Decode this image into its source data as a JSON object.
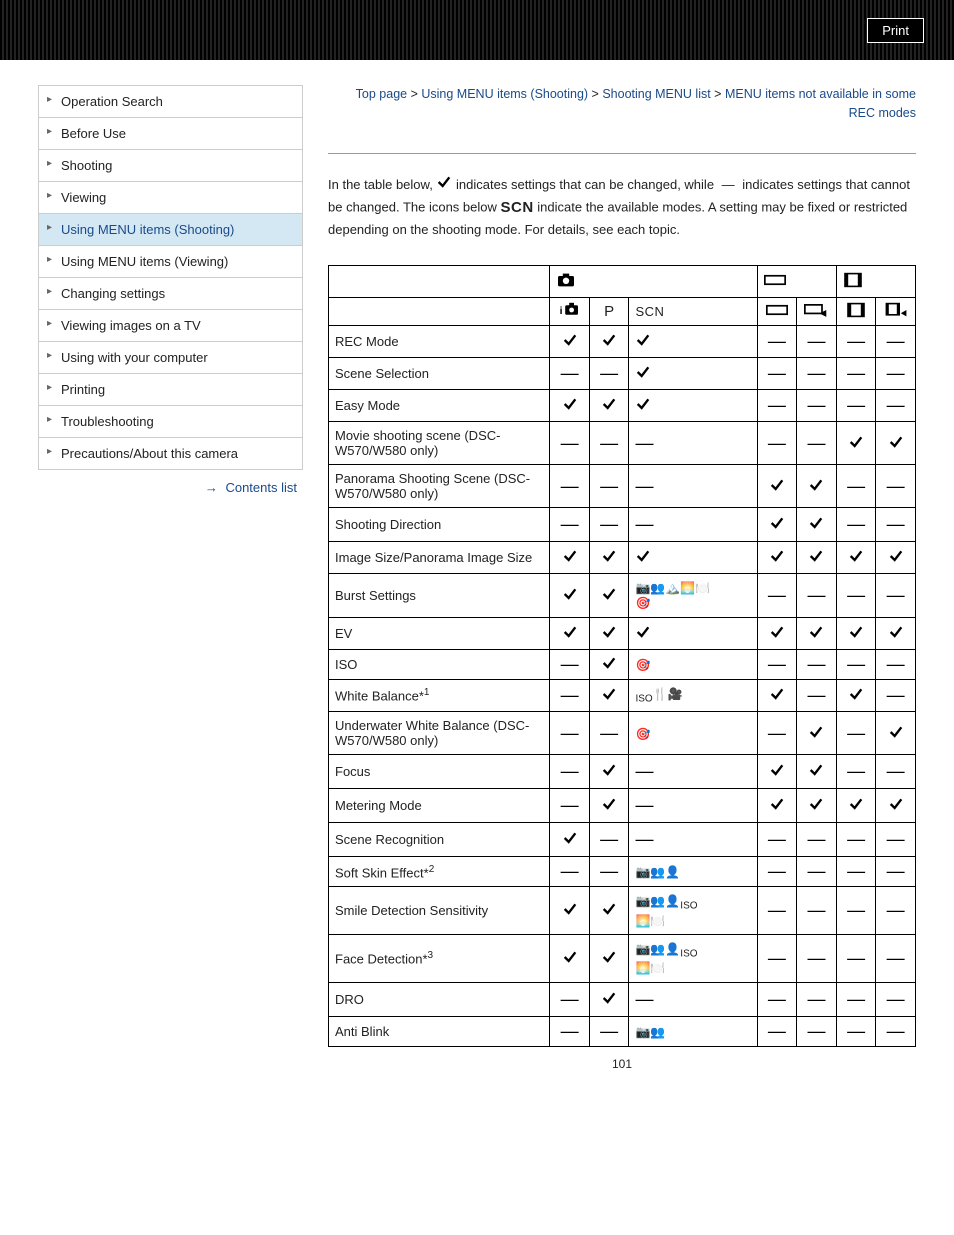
{
  "print_label": "Print",
  "breadcrumb": {
    "items": [
      "Top page",
      "Using MENU items (Shooting)",
      "Shooting MENU list",
      "MENU items not available in some REC modes"
    ],
    "sep": " > "
  },
  "sidebar": {
    "items": [
      {
        "label": "Operation Search"
      },
      {
        "label": "Before Use"
      },
      {
        "label": "Shooting"
      },
      {
        "label": "Viewing"
      },
      {
        "label": "Using MENU items (Shooting)",
        "active": true
      },
      {
        "label": "Using MENU items (Viewing)"
      },
      {
        "label": "Changing settings"
      },
      {
        "label": "Viewing images on a TV"
      },
      {
        "label": "Using with your computer"
      },
      {
        "label": "Printing"
      },
      {
        "label": "Troubleshooting"
      },
      {
        "label": "Precautions/About this camera"
      }
    ],
    "contents_label": "Contents list"
  },
  "intro": {
    "part1": "In the table below, ",
    "part2": " indicates settings that can be changed, while ",
    "part3": " indicates settings that cannot be changed. The icons below ",
    "scn": "SCN",
    "part4": " indicate the available modes. A setting may be fixed or restricted depending on the shooting mode. For details, see each topic."
  },
  "headers": {
    "camera_group": "camera",
    "panorama_group": "panorama",
    "movie_group": "movie",
    "sub": [
      "iAuto",
      "P",
      "SCN",
      "panorama",
      "panorama-plus",
      "movie",
      "movie-plus"
    ]
  },
  "rows": [
    {
      "label": "REC Mode",
      "cells": [
        "c",
        "c",
        "c",
        "",
        "d",
        "d",
        "d",
        "d"
      ]
    },
    {
      "label": "Scene Selection",
      "cells": [
        "d",
        "d",
        "c",
        "",
        "d",
        "d",
        "d",
        "d"
      ]
    },
    {
      "label": "Easy Mode",
      "cells": [
        "c",
        "c",
        "c",
        "",
        "d",
        "d",
        "d",
        "d"
      ]
    },
    {
      "label": "Movie shooting scene (DSC-W570/W580 only)",
      "cells": [
        "d",
        "d",
        "d",
        "",
        "d",
        "d",
        "c",
        "c"
      ]
    },
    {
      "label": "Panorama Shooting Scene (DSC-W570/W580 only)",
      "cells": [
        "d",
        "d",
        "d",
        "",
        "c",
        "c",
        "d",
        "d"
      ]
    },
    {
      "label": "Shooting Direction",
      "cells": [
        "d",
        "d",
        "d",
        "",
        "c",
        "c",
        "d",
        "d"
      ]
    },
    {
      "label": "Image Size/Panorama Image Size",
      "cells": [
        "c",
        "c",
        "c",
        "",
        "c",
        "c",
        "c",
        "c"
      ]
    },
    {
      "label": "Burst Settings",
      "cells": [
        "c",
        "c",
        "",
        "scn-burst",
        "d",
        "d",
        "d",
        "d"
      ]
    },
    {
      "label": "EV",
      "cells": [
        "c",
        "c",
        "c",
        "",
        "c",
        "c",
        "c",
        "c"
      ]
    },
    {
      "label": "ISO",
      "cells": [
        "d",
        "c",
        "",
        "scn-iso",
        "d",
        "d",
        "d",
        "d"
      ]
    },
    {
      "label": "White Balance",
      "sup": "1",
      "cells": [
        "d",
        "c",
        "",
        "scn-wb",
        "c",
        "d",
        "c",
        "d"
      ]
    },
    {
      "label": "Underwater White Balance (DSC-W570/W580 only)",
      "cells": [
        "d",
        "d",
        "",
        "scn-uw",
        "d",
        "c",
        "d",
        "c"
      ]
    },
    {
      "label": "Focus",
      "cells": [
        "d",
        "c",
        "d",
        "",
        "c",
        "c",
        "d",
        "d"
      ]
    },
    {
      "label": "Metering Mode",
      "cells": [
        "d",
        "c",
        "d",
        "",
        "c",
        "c",
        "c",
        "c"
      ]
    },
    {
      "label": "Scene Recognition",
      "cells": [
        "c",
        "d",
        "d",
        "",
        "d",
        "d",
        "d",
        "d"
      ]
    },
    {
      "label": "Soft Skin Effect",
      "sup": "2",
      "cells": [
        "d",
        "d",
        "",
        "scn-soft",
        "d",
        "d",
        "d",
        "d"
      ]
    },
    {
      "label": "Smile Detection Sensitivity",
      "cells": [
        "c",
        "c",
        "",
        "scn-smile",
        "d",
        "d",
        "d",
        "d"
      ]
    },
    {
      "label": "Face Detection",
      "sup": "3",
      "cells": [
        "c",
        "c",
        "",
        "scn-face",
        "d",
        "d",
        "d",
        "d"
      ]
    },
    {
      "label": "DRO",
      "cells": [
        "d",
        "c",
        "d",
        "",
        "d",
        "d",
        "d",
        "d"
      ]
    },
    {
      "label": "Anti Blink",
      "cells": [
        "d",
        "d",
        "",
        "scn-blink",
        "d",
        "d",
        "d",
        "d"
      ]
    }
  ],
  "page_number": "101"
}
